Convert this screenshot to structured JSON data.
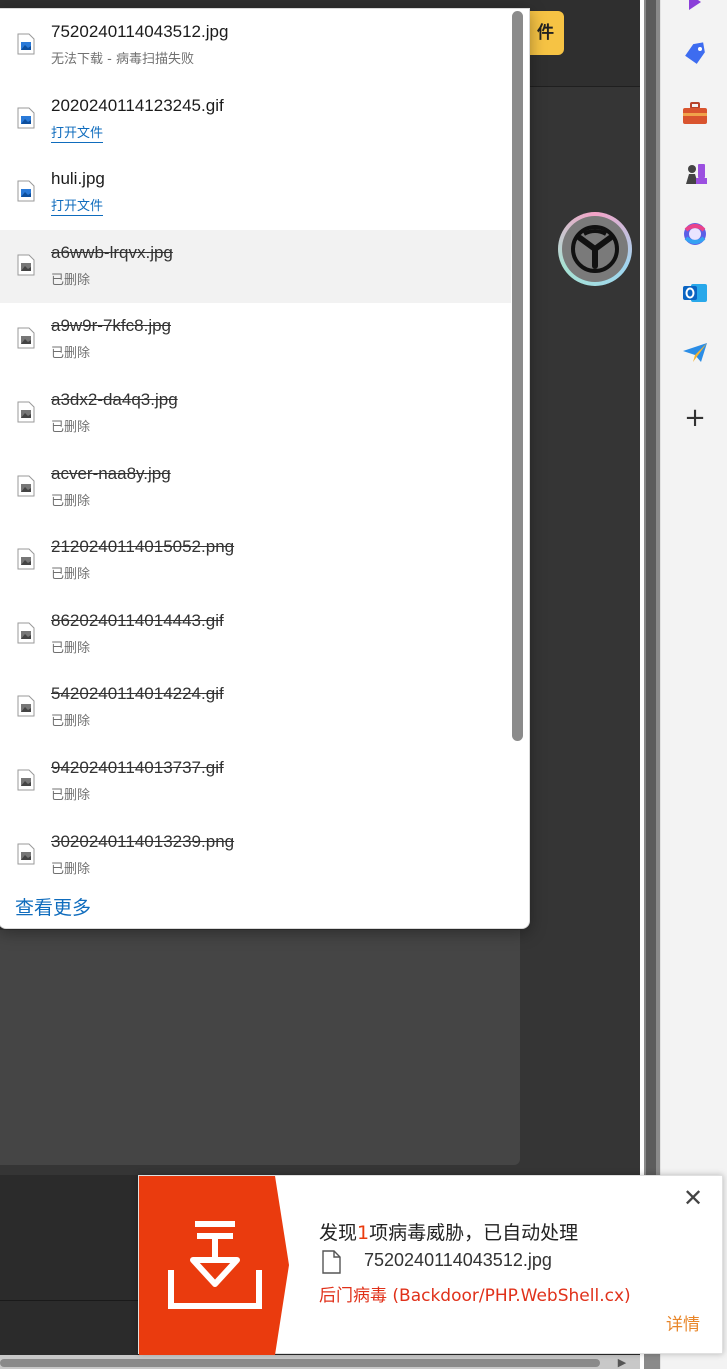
{
  "background": {
    "button_label": "件"
  },
  "downloads": {
    "items": [
      {
        "name": "7520240114043512.jpg",
        "status": "无法下载 - 病毒扫描失败",
        "deleted": false,
        "link": false
      },
      {
        "name": "2020240114123245.gif",
        "status": "打开文件",
        "deleted": false,
        "link": true
      },
      {
        "name": "huli.jpg",
        "status": "打开文件",
        "deleted": false,
        "link": true
      },
      {
        "name": "a6wwb-lrqvx.jpg",
        "status": "已删除",
        "deleted": true,
        "link": false
      },
      {
        "name": "a9w9r-7kfc8.jpg",
        "status": "已删除",
        "deleted": true,
        "link": false
      },
      {
        "name": "a3dx2-da4q3.jpg",
        "status": "已删除",
        "deleted": true,
        "link": false
      },
      {
        "name": "acver-naa8y.jpg",
        "status": "已删除",
        "deleted": true,
        "link": false
      },
      {
        "name": "2120240114015052.png",
        "status": "已删除",
        "deleted": true,
        "link": false
      },
      {
        "name": "8620240114014443.gif",
        "status": "已删除",
        "deleted": true,
        "link": false
      },
      {
        "name": "5420240114014224.gif",
        "status": "已删除",
        "deleted": true,
        "link": false
      },
      {
        "name": "9420240114013737.gif",
        "status": "已删除",
        "deleted": true,
        "link": false
      },
      {
        "name": "3020240114013239.png",
        "status": "已删除",
        "deleted": true,
        "link": false
      }
    ],
    "more_label": "查看更多"
  },
  "toast": {
    "title_prefix": "发现",
    "title_count": "1",
    "title_suffix": "项病毒威胁，已自动处理",
    "file_name": "7520240114043512.jpg",
    "virus_name": "后门病毒 (Backdoor/PHP.WebShell.cx)",
    "detail_label": "详情",
    "close_label": "✕",
    "accent_color": "#ea3b0e"
  },
  "sidebar": {
    "icons": [
      "purple-icon",
      "tag-icon",
      "toolbox-icon",
      "chess-icon",
      "microsoft365-icon",
      "outlook-icon",
      "send-icon",
      "add-icon"
    ],
    "add_label": "+"
  }
}
